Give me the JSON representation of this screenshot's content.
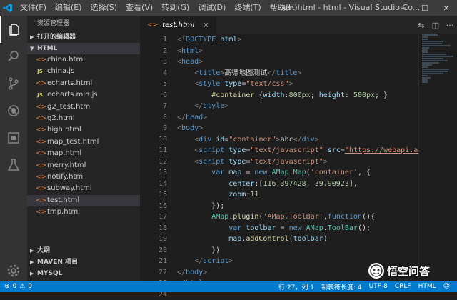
{
  "titlebar": {
    "menu": [
      "文件(F)",
      "编辑(E)",
      "选择(S)",
      "查看(V)",
      "转到(G)",
      "调试(D)",
      "终端(T)",
      "帮助(H)"
    ],
    "title": "test.html - html - Visual Studio Co..."
  },
  "sidebar": {
    "title": "资源管理器",
    "open_editors": "打开的编辑器",
    "folder": "HTML",
    "files": [
      {
        "name": "china.html",
        "type": "html"
      },
      {
        "name": "china.js",
        "type": "js"
      },
      {
        "name": "echarts.html",
        "type": "html"
      },
      {
        "name": "echarts.min.js",
        "type": "js"
      },
      {
        "name": "g2_test.html",
        "type": "html"
      },
      {
        "name": "g2.html",
        "type": "html"
      },
      {
        "name": "high.html",
        "type": "html"
      },
      {
        "name": "map_test.html",
        "type": "html"
      },
      {
        "name": "map.html",
        "type": "html"
      },
      {
        "name": "merry.html",
        "type": "html"
      },
      {
        "name": "notify.html",
        "type": "html"
      },
      {
        "name": "subway.html",
        "type": "html"
      },
      {
        "name": "test.html",
        "type": "html",
        "selected": true
      },
      {
        "name": "tmp.html",
        "type": "html"
      }
    ],
    "outline": "大纲",
    "maven": "MAVEN 项目",
    "mysql": "MYSQL"
  },
  "editor": {
    "tab_label": "test.html",
    "tab_close": "×",
    "lines": [
      {
        "n": "1",
        "tokens": [
          [
            "brk",
            "<!"
          ],
          [
            "tag",
            "DOCTYPE"
          ],
          [
            "txt",
            " "
          ],
          [
            "attr",
            "html"
          ],
          [
            "brk",
            ">"
          ]
        ]
      },
      {
        "n": "2",
        "tokens": [
          [
            "brk",
            "<"
          ],
          [
            "tag",
            "html"
          ],
          [
            "brk",
            ">"
          ]
        ]
      },
      {
        "n": "3",
        "tokens": [
          [
            "brk",
            "<"
          ],
          [
            "tag",
            "head"
          ],
          [
            "brk",
            ">"
          ]
        ]
      },
      {
        "n": "4",
        "tokens": [
          [
            "txt",
            "    "
          ],
          [
            "brk",
            "<"
          ],
          [
            "tag",
            "title"
          ],
          [
            "brk",
            ">"
          ],
          [
            "txt",
            "高德地图测试"
          ],
          [
            "brk",
            "</"
          ],
          [
            "tag",
            "title"
          ],
          [
            "brk",
            ">"
          ]
        ]
      },
      {
        "n": "5",
        "tokens": [
          [
            "txt",
            "    "
          ],
          [
            "brk",
            "<"
          ],
          [
            "tag",
            "style"
          ],
          [
            "txt",
            " "
          ],
          [
            "attr",
            "type"
          ],
          [
            "txt",
            "="
          ],
          [
            "str",
            "\"text/css\""
          ],
          [
            "brk",
            ">"
          ]
        ]
      },
      {
        "n": "6",
        "tokens": [
          [
            "txt",
            "        "
          ],
          [
            "fn",
            "#container"
          ],
          [
            "txt",
            " {"
          ],
          [
            "attr",
            "width"
          ],
          [
            "txt",
            ":"
          ],
          [
            "num",
            "800px"
          ],
          [
            "txt",
            "; "
          ],
          [
            "attr",
            "height"
          ],
          [
            "txt",
            ": "
          ],
          [
            "num",
            "500px"
          ],
          [
            "txt",
            "; }"
          ]
        ]
      },
      {
        "n": "7",
        "tokens": [
          [
            "txt",
            "    "
          ],
          [
            "brk",
            "</"
          ],
          [
            "tag",
            "style"
          ],
          [
            "brk",
            ">"
          ]
        ]
      },
      {
        "n": "8",
        "tokens": [
          [
            "brk",
            "</"
          ],
          [
            "tag",
            "head"
          ],
          [
            "brk",
            ">"
          ]
        ]
      },
      {
        "n": "9",
        "tokens": [
          [
            "brk",
            "<"
          ],
          [
            "tag",
            "body"
          ],
          [
            "brk",
            ">"
          ]
        ]
      },
      {
        "n": "10",
        "tokens": [
          [
            "txt",
            "    "
          ],
          [
            "brk",
            "<"
          ],
          [
            "tag",
            "div"
          ],
          [
            "txt",
            " "
          ],
          [
            "attr",
            "id"
          ],
          [
            "txt",
            "="
          ],
          [
            "str",
            "\"container\""
          ],
          [
            "brk",
            ">"
          ],
          [
            "txt",
            "abc"
          ],
          [
            "brk",
            "</"
          ],
          [
            "tag",
            "div"
          ],
          [
            "brk",
            ">"
          ]
        ]
      },
      {
        "n": "11",
        "tokens": [
          [
            "txt",
            "    "
          ],
          [
            "brk",
            "<"
          ],
          [
            "tag",
            "script"
          ],
          [
            "txt",
            " "
          ],
          [
            "attr",
            "type"
          ],
          [
            "txt",
            "="
          ],
          [
            "str",
            "\"text/javascript\""
          ],
          [
            "txt",
            " "
          ],
          [
            "attr",
            "src"
          ],
          [
            "txt",
            "="
          ],
          [
            "url",
            "\"https://webapi.amap"
          ]
        ]
      },
      {
        "n": "12",
        "tokens": [
          [
            "txt",
            "    "
          ],
          [
            "brk",
            "<"
          ],
          [
            "tag",
            "script"
          ],
          [
            "txt",
            " "
          ],
          [
            "attr",
            "type"
          ],
          [
            "txt",
            "="
          ],
          [
            "str",
            "\"text/javascript\""
          ],
          [
            "brk",
            ">"
          ]
        ]
      },
      {
        "n": "13",
        "tokens": [
          [
            "txt",
            "        "
          ],
          [
            "key",
            "var"
          ],
          [
            "txt",
            " "
          ],
          [
            "attr",
            "map"
          ],
          [
            "txt",
            " = "
          ],
          [
            "key",
            "new"
          ],
          [
            "txt",
            " "
          ],
          [
            "cls",
            "AMap"
          ],
          [
            "txt",
            "."
          ],
          [
            "cls",
            "Map"
          ],
          [
            "txt",
            "("
          ],
          [
            "str",
            "'container'"
          ],
          [
            "txt",
            ", {"
          ]
        ]
      },
      {
        "n": "14",
        "tokens": [
          [
            "txt",
            "            "
          ],
          [
            "attr",
            "center"
          ],
          [
            "txt",
            ":["
          ],
          [
            "num",
            "116.397428"
          ],
          [
            "txt",
            ", "
          ],
          [
            "num",
            "39.90923"
          ],
          [
            "txt",
            "],"
          ]
        ]
      },
      {
        "n": "15",
        "tokens": [
          [
            "txt",
            "            "
          ],
          [
            "attr",
            "zoom"
          ],
          [
            "txt",
            ":"
          ],
          [
            "num",
            "11"
          ]
        ]
      },
      {
        "n": "16",
        "tokens": [
          [
            "txt",
            "        });"
          ]
        ]
      },
      {
        "n": "17",
        "tokens": [
          [
            "txt",
            "        "
          ],
          [
            "cls",
            "AMap"
          ],
          [
            "txt",
            "."
          ],
          [
            "fn",
            "plugin"
          ],
          [
            "txt",
            "("
          ],
          [
            "str",
            "'AMap.ToolBar'"
          ],
          [
            "txt",
            ","
          ],
          [
            "key",
            "function"
          ],
          [
            "txt",
            "(){"
          ]
        ]
      },
      {
        "n": "18",
        "tokens": [
          [
            "txt",
            "            "
          ],
          [
            "key",
            "var"
          ],
          [
            "txt",
            " "
          ],
          [
            "attr",
            "toolbar"
          ],
          [
            "txt",
            " = "
          ],
          [
            "key",
            "new"
          ],
          [
            "txt",
            " "
          ],
          [
            "cls",
            "AMap"
          ],
          [
            "txt",
            "."
          ],
          [
            "cls",
            "ToolBar"
          ],
          [
            "txt",
            "();"
          ]
        ]
      },
      {
        "n": "19",
        "tokens": [
          [
            "txt",
            "            "
          ],
          [
            "attr",
            "map"
          ],
          [
            "txt",
            "."
          ],
          [
            "fn",
            "addControl"
          ],
          [
            "txt",
            "("
          ],
          [
            "attr",
            "toolbar"
          ],
          [
            "txt",
            ")"
          ]
        ]
      },
      {
        "n": "20",
        "tokens": [
          [
            "txt",
            "        })"
          ]
        ]
      },
      {
        "n": "21",
        "tokens": [
          [
            "txt",
            "    "
          ],
          [
            "brk",
            "</"
          ],
          [
            "tag",
            "script"
          ],
          [
            "brk",
            ">"
          ]
        ]
      },
      {
        "n": "22",
        "tokens": [
          [
            "brk",
            "</"
          ],
          [
            "tag",
            "body"
          ],
          [
            "brk",
            ">"
          ]
        ]
      },
      {
        "n": "23",
        "tokens": [
          [
            "brk",
            "</"
          ],
          [
            "tag",
            "html"
          ],
          [
            "brk",
            ">"
          ]
        ]
      },
      {
        "n": "24",
        "tokens": []
      }
    ]
  },
  "statusbar": {
    "errors": "0",
    "warnings": "0",
    "position": "行 27，列 1",
    "indent": "制表符长度: 4",
    "encoding": "UTF-8",
    "eol": "CRLF",
    "language": "HTML"
  },
  "watermark": "悟空问答",
  "colors": {
    "accent": "#007acc",
    "activity_bar": "#333333",
    "sidebar": "#252526",
    "editor": "#1e1e1e"
  }
}
